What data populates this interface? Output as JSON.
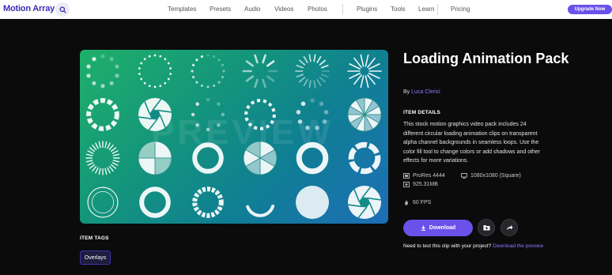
{
  "header": {
    "logo": "Motion Array",
    "nav": [
      "Templates",
      "Presets",
      "Audio",
      "Videos",
      "Photos",
      "Plugins",
      "Tools",
      "Learn",
      "Pricing"
    ],
    "upgrade_label": "Upgrade Now"
  },
  "preview": {
    "watermark": "PREVIEW"
  },
  "product": {
    "title": "Loading Animation Pack",
    "by_prefix": "By ",
    "author": "Luca Clerici",
    "details_heading": "ITEM DETAILS",
    "description": "This stock motion graphics video pack includes 24 different circular loading animation clips on transparent alpha channel backgrounds in seamless loops. Use the color fill tool to change colors or add shadows and other effects for more variations.",
    "specs": {
      "codec": "ProRes 4444",
      "resolution": "1080x1080 (Square)",
      "size": "925.31MB",
      "fps": "60 FPS"
    },
    "download_label": "Download",
    "test_prompt": "Need to test this clip with your project?",
    "test_link": "Download the preview"
  },
  "tags": {
    "heading": "ITEM TAGS",
    "items": [
      "Overlays"
    ]
  },
  "colors": {
    "accent": "#6b51e9",
    "link": "#8b7bff",
    "background": "#0b0b0c"
  }
}
